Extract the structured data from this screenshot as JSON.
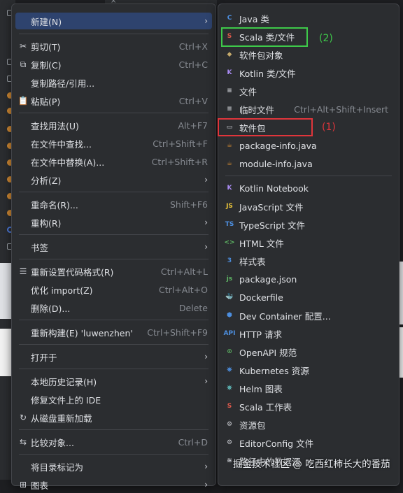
{
  "left_menu": {
    "items": [
      {
        "icon": "",
        "label": "新建(N)",
        "shortcut": "",
        "arrow": true,
        "selected": true
      },
      {
        "icon": "scissors-icon",
        "label": "剪切(T)",
        "shortcut": "Ctrl+X"
      },
      {
        "icon": "copy-icon",
        "label": "复制(C)",
        "shortcut": "Ctrl+C"
      },
      {
        "icon": "",
        "label": "复制路径/引用...",
        "shortcut": ""
      },
      {
        "icon": "paste-icon",
        "label": "粘贴(P)",
        "shortcut": "Ctrl+V"
      },
      {
        "icon": "",
        "label": "查找用法(U)",
        "shortcut": "Alt+F7"
      },
      {
        "icon": "",
        "label": "在文件中查找...",
        "shortcut": "Ctrl+Shift+F"
      },
      {
        "icon": "",
        "label": "在文件中替换(A)...",
        "shortcut": "Ctrl+Shift+R"
      },
      {
        "icon": "",
        "label": "分析(Z)",
        "shortcut": "",
        "arrow": true
      },
      {
        "icon": "",
        "label": "重命名(R)...",
        "shortcut": "Shift+F6"
      },
      {
        "icon": "",
        "label": "重构(R)",
        "shortcut": "",
        "arrow": true
      },
      {
        "icon": "",
        "label": "书签",
        "shortcut": "",
        "arrow": true
      },
      {
        "icon": "reformat-icon",
        "label": "重新设置代码格式(R)",
        "shortcut": "Ctrl+Alt+L"
      },
      {
        "icon": "",
        "label": "优化 import(Z)",
        "shortcut": "Ctrl+Alt+O"
      },
      {
        "icon": "",
        "label": "删除(D)...",
        "shortcut": "Delete"
      },
      {
        "icon": "",
        "label": "重新构建(E) 'luwenzhen'",
        "shortcut": "Ctrl+Shift+F9"
      },
      {
        "icon": "",
        "label": "打开于",
        "shortcut": "",
        "arrow": true
      },
      {
        "icon": "",
        "label": "本地历史记录(H)",
        "shortcut": "",
        "arrow": true
      },
      {
        "icon": "",
        "label": "修复文件上的 IDE",
        "shortcut": ""
      },
      {
        "icon": "reload-icon",
        "label": "从磁盘重新加载",
        "shortcut": ""
      },
      {
        "icon": "compare-icon",
        "label": "比较对象...",
        "shortcut": "Ctrl+D"
      },
      {
        "icon": "",
        "label": "将目录标记为",
        "shortcut": "",
        "arrow": true
      },
      {
        "icon": "diagram-icon",
        "label": "图表",
        "shortcut": "",
        "arrow": true
      }
    ]
  },
  "right_menu": {
    "items": [
      {
        "icon": "java-class-icon",
        "glyph": "C",
        "color": "#4d8fe0",
        "label": "Java 类",
        "shortcut": ""
      },
      {
        "icon": "scala-class-icon",
        "glyph": "S",
        "color": "#e05a4c",
        "label": "Scala 类/文件",
        "shortcut": ""
      },
      {
        "icon": "package-object-icon",
        "glyph": "◆",
        "color": "#c4a96b",
        "label": "软件包对象",
        "shortcut": ""
      },
      {
        "icon": "kotlin-icon",
        "glyph": "K",
        "color": "#a98bf2",
        "label": "Kotlin 类/文件",
        "shortcut": ""
      },
      {
        "icon": "file-icon",
        "glyph": "≡",
        "color": "#ced0d6",
        "label": "文件",
        "shortcut": ""
      },
      {
        "icon": "scratch-file-icon",
        "glyph": "≡",
        "color": "#ced0d6",
        "label": "临时文件",
        "shortcut": "Ctrl+Alt+Shift+Insert"
      },
      {
        "icon": "package-icon",
        "glyph": "▭",
        "color": "#ced0d6",
        "label": "软件包",
        "shortcut": ""
      },
      {
        "icon": "java-file-icon",
        "glyph": "☕",
        "color": "#d18a33",
        "label": "package-info.java",
        "shortcut": ""
      },
      {
        "icon": "java-file-icon",
        "glyph": "☕",
        "color": "#d18a33",
        "label": "module-info.java",
        "shortcut": ""
      },
      {
        "icon": "kotlin-notebook-icon",
        "glyph": "K",
        "color": "#a98bf2",
        "label": "Kotlin Notebook",
        "shortcut": ""
      },
      {
        "icon": "javascript-icon",
        "glyph": "JS",
        "color": "#e8c33a",
        "label": "JavaScript 文件",
        "shortcut": ""
      },
      {
        "icon": "typescript-icon",
        "glyph": "TS",
        "color": "#4d8fe0",
        "label": "TypeScript 文件",
        "shortcut": ""
      },
      {
        "icon": "html-icon",
        "glyph": "<>",
        "color": "#5fb865",
        "label": "HTML 文件",
        "shortcut": ""
      },
      {
        "icon": "css-icon",
        "glyph": "3",
        "color": "#4d8fe0",
        "label": "样式表",
        "shortcut": ""
      },
      {
        "icon": "nodejs-icon",
        "glyph": "js",
        "color": "#5fb865",
        "label": "package.json",
        "shortcut": ""
      },
      {
        "icon": "docker-icon",
        "glyph": "🐳",
        "color": "#4d8fe0",
        "label": "Dockerfile",
        "shortcut": ""
      },
      {
        "icon": "dev-container-icon",
        "glyph": "⬢",
        "color": "#4d8fe0",
        "label": "Dev Container 配置...",
        "shortcut": ""
      },
      {
        "icon": "http-api-icon",
        "glyph": "API",
        "color": "#4d8fe0",
        "label": "HTTP 请求",
        "shortcut": ""
      },
      {
        "icon": "openapi-icon",
        "glyph": "⊙",
        "color": "#5fb865",
        "label": "OpenAPI 规范",
        "shortcut": ""
      },
      {
        "icon": "kubernetes-icon",
        "glyph": "⎈",
        "color": "#4d8fe0",
        "label": "Kubernetes 资源",
        "shortcut": ""
      },
      {
        "icon": "helm-icon",
        "glyph": "⎈",
        "color": "#5fb8b8",
        "label": "Helm 图表",
        "shortcut": ""
      },
      {
        "icon": "scala-worksheet-icon",
        "glyph": "S",
        "color": "#e05a4c",
        "label": "Scala 工作表",
        "shortcut": ""
      },
      {
        "icon": "resource-bundle-icon",
        "glyph": "⚙",
        "color": "#ced0d6",
        "label": "资源包",
        "shortcut": ""
      },
      {
        "icon": "editorconfig-icon",
        "glyph": "⚙",
        "color": "#ced0d6",
        "label": "EditorConfig 文件",
        "shortcut": ""
      },
      {
        "icon": "data-source-icon",
        "glyph": "≋",
        "color": "#ced0d6",
        "label": "路径中的数据源",
        "shortcut": ""
      }
    ]
  },
  "annotations": {
    "green_label": "(2)",
    "red_label": "(1)",
    "green_color": "#3ec94a",
    "red_color": "#e0353b"
  },
  "watermark": "掘金技术社区 @ 吃西红柿长大的番茄"
}
